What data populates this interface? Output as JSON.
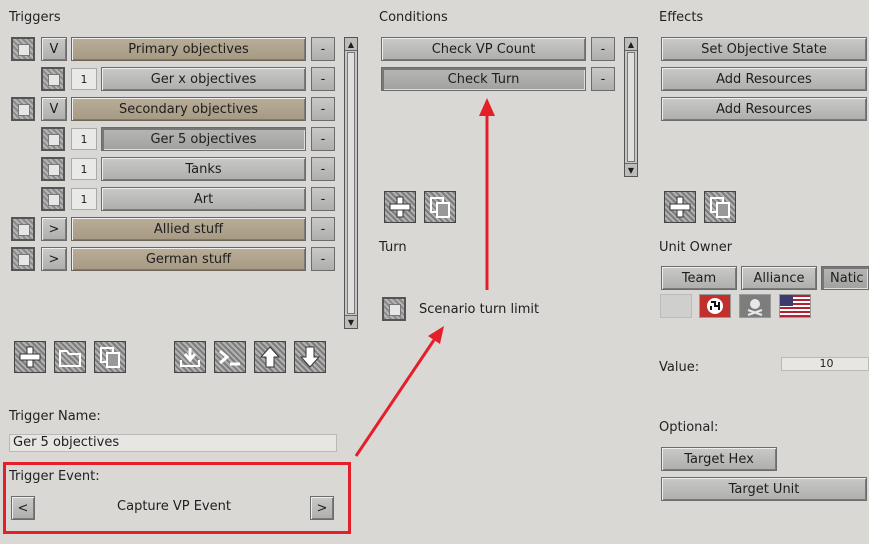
{
  "triggers": {
    "header": "Triggers",
    "rows": [
      {
        "toggle": "V",
        "label": "Primary objectives",
        "minus": "-"
      },
      {
        "num": "1",
        "label": "Ger x objectives",
        "minus": "-"
      },
      {
        "toggle": "V",
        "label": "Secondary objectives",
        "minus": "-"
      },
      {
        "num": "1",
        "label": "Ger 5 objectives",
        "minus": "-"
      },
      {
        "num": "1",
        "label": "Tanks",
        "minus": "-"
      },
      {
        "num": "1",
        "label": "Art",
        "minus": "-"
      },
      {
        "toggle": ">",
        "label": "Allied stuff",
        "minus": "-"
      },
      {
        "toggle": ">",
        "label": "German stuff",
        "minus": "-"
      }
    ],
    "name_label": "Trigger Name:",
    "name_value": "Ger 5 objectives",
    "event_label": "Trigger Event:",
    "event_prev": "<",
    "event_value": "Capture VP Event",
    "event_next": ">"
  },
  "conditions": {
    "header": "Conditions",
    "rows": [
      {
        "label": "Check VP Count",
        "minus": "-"
      },
      {
        "label": "Check Turn",
        "minus": "-"
      }
    ],
    "turn_header": "Turn",
    "turn_limit_label": "Scenario turn limit"
  },
  "effects": {
    "header": "Effects",
    "rows": [
      {
        "label": "Set Objective State"
      },
      {
        "label": "Add Resources"
      },
      {
        "label": "Add Resources"
      }
    ],
    "unit_owner_label": "Unit Owner",
    "owner_tabs": [
      "Team",
      "Alliance",
      "Natic"
    ],
    "value_label": "Value:",
    "value": "10",
    "optional_label": "Optional:",
    "target_hex": "Target Hex",
    "target_unit": "Target Unit"
  },
  "colors": {
    "annotation_red": "#e3202a",
    "tan_button": "#b0a48e"
  }
}
